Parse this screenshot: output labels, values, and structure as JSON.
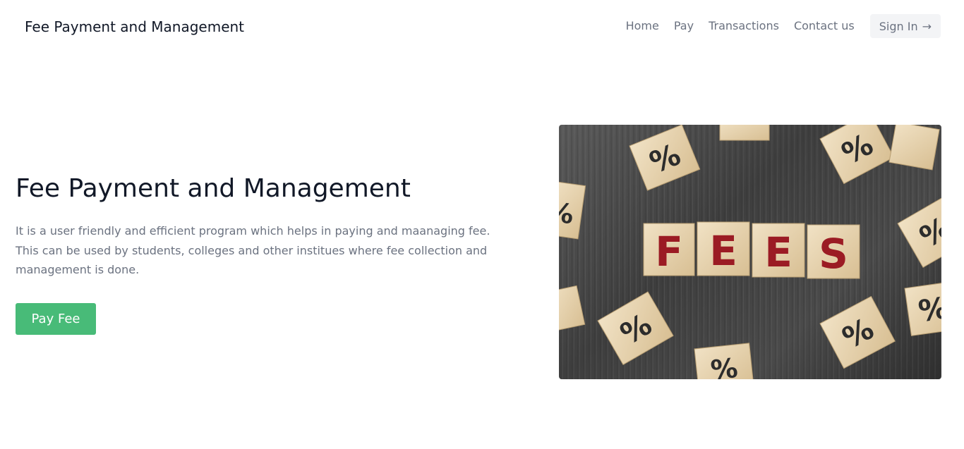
{
  "header": {
    "brand": "Fee Payment and Management",
    "nav": [
      "Home",
      "Pay",
      "Transactions",
      "Contact us"
    ],
    "signin_label": "Sign In",
    "signin_icon": "arrow-right-icon"
  },
  "hero": {
    "title": "Fee Payment and Management",
    "description": "It is a user friendly and efficient program which helps in paying and maanaging fee. This can be used by students, colleges and other institues where fee collection and management is done.",
    "button_label": "Pay Fee",
    "image": {
      "block_letters": [
        "F",
        "E",
        "E",
        "S"
      ],
      "percent_symbol": "%"
    }
  },
  "colors": {
    "accent_green": "#48bb78",
    "nav_text": "#6b7280",
    "heading": "#111827",
    "letter_red": "#9b1b24"
  }
}
